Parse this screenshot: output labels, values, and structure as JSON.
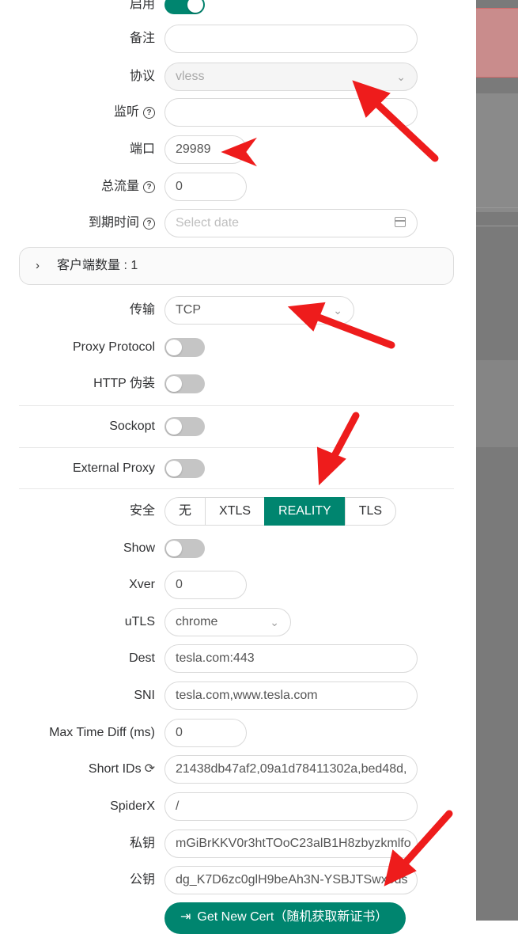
{
  "form": {
    "enable_label": "启用",
    "remark_label": "备注",
    "remark_value": "",
    "protocol_label": "协议",
    "protocol_value": "vless",
    "listen_label": "监听",
    "listen_value": "",
    "port_label": "端口",
    "port_value": "29989",
    "total_traffic_label": "总流量",
    "total_traffic_value": "0",
    "expiry_label": "到期时间",
    "expiry_placeholder": "Select date",
    "clients_title": "客户端数量 : 1",
    "transport_label": "传输",
    "transport_value": "TCP",
    "proxy_protocol_label": "Proxy Protocol",
    "http_disguise_label": "HTTP 伪装",
    "sockopt_label": "Sockopt",
    "external_proxy_label": "External Proxy",
    "security_label": "安全",
    "security_options": [
      "无",
      "XTLS",
      "REALITY",
      "TLS"
    ],
    "security_selected": "REALITY",
    "show_label": "Show",
    "xver_label": "Xver",
    "xver_value": "0",
    "utls_label": "uTLS",
    "utls_value": "chrome",
    "dest_label": "Dest",
    "dest_value": "tesla.com:443",
    "sni_label": "SNI",
    "sni_value": "tesla.com,www.tesla.com",
    "max_time_diff_label": "Max Time Diff (ms)",
    "max_time_diff_value": "0",
    "short_ids_label": "Short IDs",
    "short_ids_value": "21438db47af2,09a1d78411302a,bed48d,",
    "spiderx_label": "SpiderX",
    "spiderx_value": "/",
    "private_key_label": "私钥",
    "private_key_value": "mGiBrKKV0r3htTOoC23alB1H8zbyzkmlfo",
    "public_key_label": "公钥",
    "public_key_value": "dg_K7D6zc0glH9beAh3N-YSBJTSwx5ds",
    "get_cert_label": "Get New Cert（随机获取新证书）"
  },
  "switches": {
    "enable": true,
    "proxy_protocol": false,
    "http_disguise": false,
    "sockopt": false,
    "external_proxy": false,
    "show": false
  },
  "colors": {
    "accent": "#00856f",
    "annotation_arrow": "#ee1c1c"
  }
}
